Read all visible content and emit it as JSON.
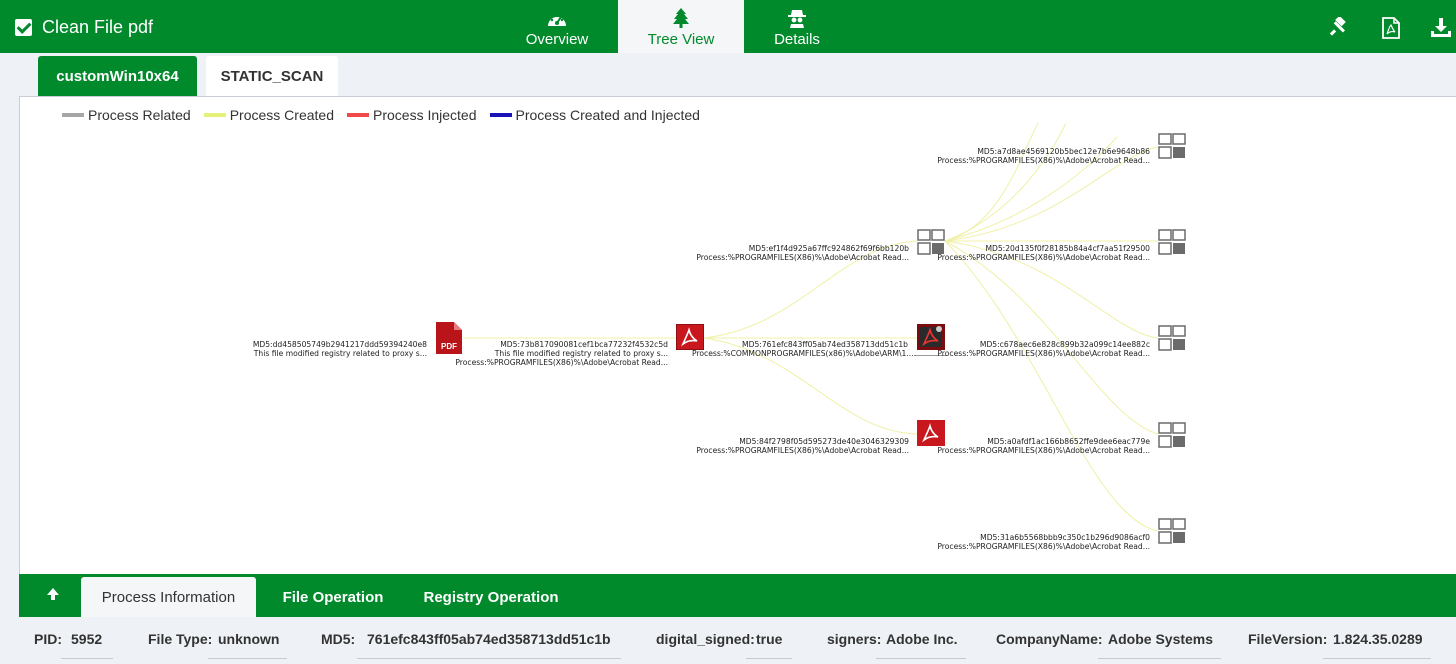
{
  "header": {
    "title": "Clean File pdf",
    "tabs": [
      {
        "label": "Overview",
        "icon": "dashboard-icon"
      },
      {
        "label": "Tree View",
        "icon": "tree-icon"
      },
      {
        "label": "Details",
        "icon": "spy-icon"
      }
    ],
    "active_tab": "Tree View",
    "tools": [
      "gavel-icon",
      "pdf-file-icon",
      "download-icon"
    ]
  },
  "env_tabs": [
    {
      "label": "customWin10x64",
      "active": true
    },
    {
      "label": "STATIC_SCAN",
      "active": false
    }
  ],
  "legend": [
    {
      "label": "Process Related",
      "color": "#a6a6a6"
    },
    {
      "label": "Process Created",
      "color": "#e4f27a"
    },
    {
      "label": "Process Injected",
      "color": "#f04a4a"
    },
    {
      "label": "Process Created and Injected",
      "color": "#1a14b8"
    }
  ],
  "graph": {
    "edge_color": "#f0f0a6",
    "nodes": [
      {
        "icon": "pdf-document-icon",
        "md5": "MD5:dd458505749b2941217ddd59394240e8",
        "line2": "This file modified registry related to proxy s...",
        "line3": ""
      },
      {
        "icon": "acrobat-icon",
        "md5": "MD5:73b817090081cef1bca77232f4532c5d",
        "line2": "This file modified registry related to proxy s...",
        "line3": "Process:%PROGRAMFILES(X86)%\\Adobe\\Acrobat Read..."
      },
      {
        "icon": "process-grid-icon",
        "md5": "MD5:ef1f4d925a67ffc924862f69f6bb120b",
        "line2": "Process:%PROGRAMFILES(X86)%\\Adobe\\Acrobat Read...",
        "line3": ""
      },
      {
        "icon": "acrobat-arm-icon",
        "md5": "MD5:761efc843ff05ab74ed358713dd51c1b",
        "line2": "Process:%COMMONPROGRAMFILES(x86)%\\Adobe\\ARM\\1....",
        "line3": ""
      },
      {
        "icon": "acrobat-icon",
        "md5": "MD5:84f2798f05d595273de40e3046329309",
        "line2": "Process:%PROGRAMFILES(X86)%\\Adobe\\Acrobat Read...",
        "line3": ""
      },
      {
        "icon": "process-grid-icon",
        "md5": "MD5:a7d8ae4569120b5bec12e7b6e9648b86",
        "line2": "Process:%PROGRAMFILES(X86)%\\Adobe\\Acrobat Read...",
        "line3": ""
      },
      {
        "icon": "process-grid-icon",
        "md5": "MD5:20d135f0f28185b84a4cf7aa51f29500",
        "line2": "Process:%PROGRAMFILES(X86)%\\Adobe\\Acrobat Read...",
        "line3": ""
      },
      {
        "icon": "process-grid-icon",
        "md5": "MD5:c678aec6e828c899b32a099c14ee882c",
        "line2": "Process:%PROGRAMFILES(X86)%\\Adobe\\Acrobat Read...",
        "line3": ""
      },
      {
        "icon": "process-grid-icon",
        "md5": "MD5:a0afdf1ac166b8652ffe9dee6eac779e",
        "line2": "Process:%PROGRAMFILES(X86)%\\Adobe\\Acrobat Read...",
        "line3": ""
      },
      {
        "icon": "process-grid-icon",
        "md5": "MD5:31a6b5568bbb9c350c1b296d9086acf0",
        "line2": "Process:%PROGRAMFILES(X86)%\\Adobe\\Acrobat Read...",
        "line3": ""
      }
    ]
  },
  "bottom_tabs": [
    {
      "label": "Process Information",
      "active": true
    },
    {
      "label": "File Operation",
      "active": false
    },
    {
      "label": "Registry Operation",
      "active": false
    }
  ],
  "info": [
    {
      "label": "PID:",
      "value": "5952"
    },
    {
      "label": "File Type:",
      "value": "unknown"
    },
    {
      "label": "MD5:",
      "value": "761efc843ff05ab74ed358713dd51c1b"
    },
    {
      "label": "digital_signed:",
      "value": "true"
    },
    {
      "label": "signers:",
      "value": "Adobe Inc."
    },
    {
      "label": "CompanyName:",
      "value": "Adobe Systems"
    },
    {
      "label": "FileVersion:",
      "value": "1.824.35.0289"
    }
  ],
  "colors": {
    "brand": "#008a2b",
    "acrobat_red": "#c8171d"
  }
}
